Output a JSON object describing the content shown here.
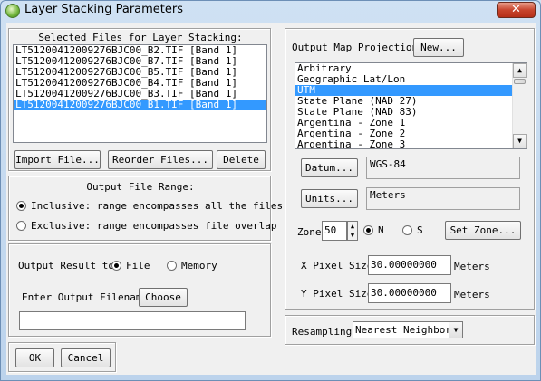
{
  "window": {
    "title": "Layer Stacking Parameters",
    "close_glyph": "✕"
  },
  "files": {
    "header": "Selected Files for Layer Stacking:",
    "items": [
      "LT51200412009276BJC00_B2.TIF [Band 1]",
      "LT51200412009276BJC00_B7.TIF [Band 1]",
      "LT51200412009276BJC00_B5.TIF [Band 1]",
      "LT51200412009276BJC00_B4.TIF [Band 1]",
      "LT51200412009276BJC00_B3.TIF [Band 1]",
      "LT51200412009276BJC00_B1.TIF [Band 1]"
    ],
    "selected_index": 5,
    "import_label": "Import File...",
    "reorder_label": "Reorder Files...",
    "delete_label": "Delete"
  },
  "range": {
    "header": "Output File Range:",
    "inclusive_label": "Inclusive: range encompasses all the files",
    "exclusive_label": "Exclusive: range encompasses file overlap",
    "selected": "inclusive"
  },
  "output": {
    "result_to_label": "Output Result to",
    "file_label": "File",
    "memory_label": "Memory",
    "selected": "file",
    "filename_label": "Enter Output Filename",
    "choose_label": "Choose",
    "filename_value": ""
  },
  "buttons": {
    "ok_label": "OK",
    "cancel_label": "Cancel"
  },
  "projection": {
    "header": "Output Map Projection",
    "new_label": "New...",
    "items": [
      "Arbitrary",
      "Geographic Lat/Lon",
      "UTM",
      "State Plane (NAD 27)",
      "State Plane (NAD 83)",
      "Argentina - Zone 1",
      "Argentina - Zone 2",
      "Argentina - Zone 3"
    ],
    "selected_index": 2,
    "datum_label": "Datum...",
    "datum_value": "WGS-84",
    "units_label": "Units...",
    "units_value": "Meters",
    "zone_label": "Zone",
    "zone_value": "50",
    "north_label": "N",
    "south_label": "S",
    "hemisphere": "N",
    "set_zone_label": "Set Zone...",
    "x_pixel_label": "X Pixel Size",
    "x_pixel_value": "30.00000000",
    "x_pixel_units": "Meters",
    "y_pixel_label": "Y Pixel Size",
    "y_pixel_value": "30.00000000",
    "y_pixel_units": "Meters"
  },
  "resampling": {
    "label": "Resampling",
    "value": "Nearest Neighbor"
  }
}
